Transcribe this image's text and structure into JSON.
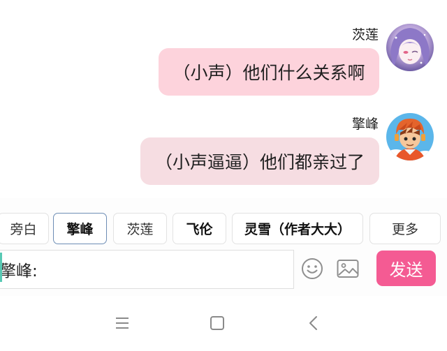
{
  "messages": [
    {
      "sender": "茨莲",
      "text": "（小声）他们什么关系啊",
      "bubble_color": "#fdd3dc",
      "avatar": "anime-girl-purple-hair"
    },
    {
      "sender": "擎峰",
      "text": "（小声逼逼）他们都亲过了",
      "bubble_color": "#f6dde2",
      "avatar": "cartoon-boy-orange-helmet"
    }
  ],
  "characters": [
    {
      "label": "旁白",
      "selected": false,
      "bold": false
    },
    {
      "label": "擎峰",
      "selected": true,
      "bold": true
    },
    {
      "label": "茨莲",
      "selected": false,
      "bold": false
    },
    {
      "label": "飞伦",
      "selected": false,
      "bold": true
    },
    {
      "label": "灵雪（作者大大）",
      "selected": false,
      "bold": true
    }
  ],
  "more_label": "更多",
  "input": {
    "value": "擎峰:"
  },
  "send_label": "发送",
  "icons": {
    "emoji": "emoji-icon",
    "image": "image-icon",
    "menu": "menu-icon",
    "home": "home-square-icon",
    "back": "back-chevron-icon"
  },
  "colors": {
    "send_button": "#f45b93",
    "selected_border": "#6d8db5"
  }
}
